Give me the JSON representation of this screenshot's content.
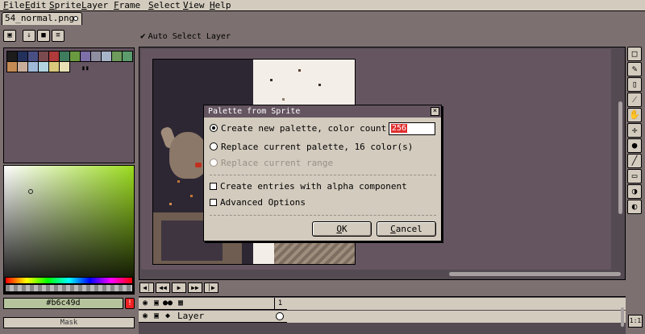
{
  "menubar": {
    "items": [
      "File",
      "Edit",
      "Sprite",
      "Layer",
      "Frame",
      "Select",
      "View",
      "Help"
    ]
  },
  "tabs": [
    {
      "label": "54_normal.png"
    }
  ],
  "toolbar": {
    "auto_select_label": "Auto Select Layer"
  },
  "palette": {
    "colors": [
      "#1c1c1c",
      "#22305b",
      "#4a4f83",
      "#7b4a4f",
      "#b13a3a",
      "#3f7b5d",
      "#6a9a3f",
      "#7d6fa7",
      "#8f8ea0",
      "#a7b4c8",
      "#6e9b5c",
      "#5b9b6c",
      "#c48a54",
      "#c8ad9b",
      "#9fb8d8",
      "#b2d3e0",
      "#d8c87a",
      "#e8e0b5"
    ]
  },
  "color_bar": {
    "value": "#b6c49d"
  },
  "mask_label": "Mask",
  "dialog": {
    "title": "Palette from Sprite",
    "option_new_palette": "Create new palette, color count limit:",
    "color_count_value": "256",
    "option_replace_palette": "Replace current palette, 16 color(s)",
    "option_replace_range": "Replace current range",
    "option_alpha": "Create entries with alpha component",
    "option_advanced": "Advanced Options",
    "ok_label": "OK",
    "cancel_label": "Cancel"
  },
  "timeline": {
    "frame_number": "1",
    "layer_name": "Layer"
  },
  "zoom_label": "1:1"
}
